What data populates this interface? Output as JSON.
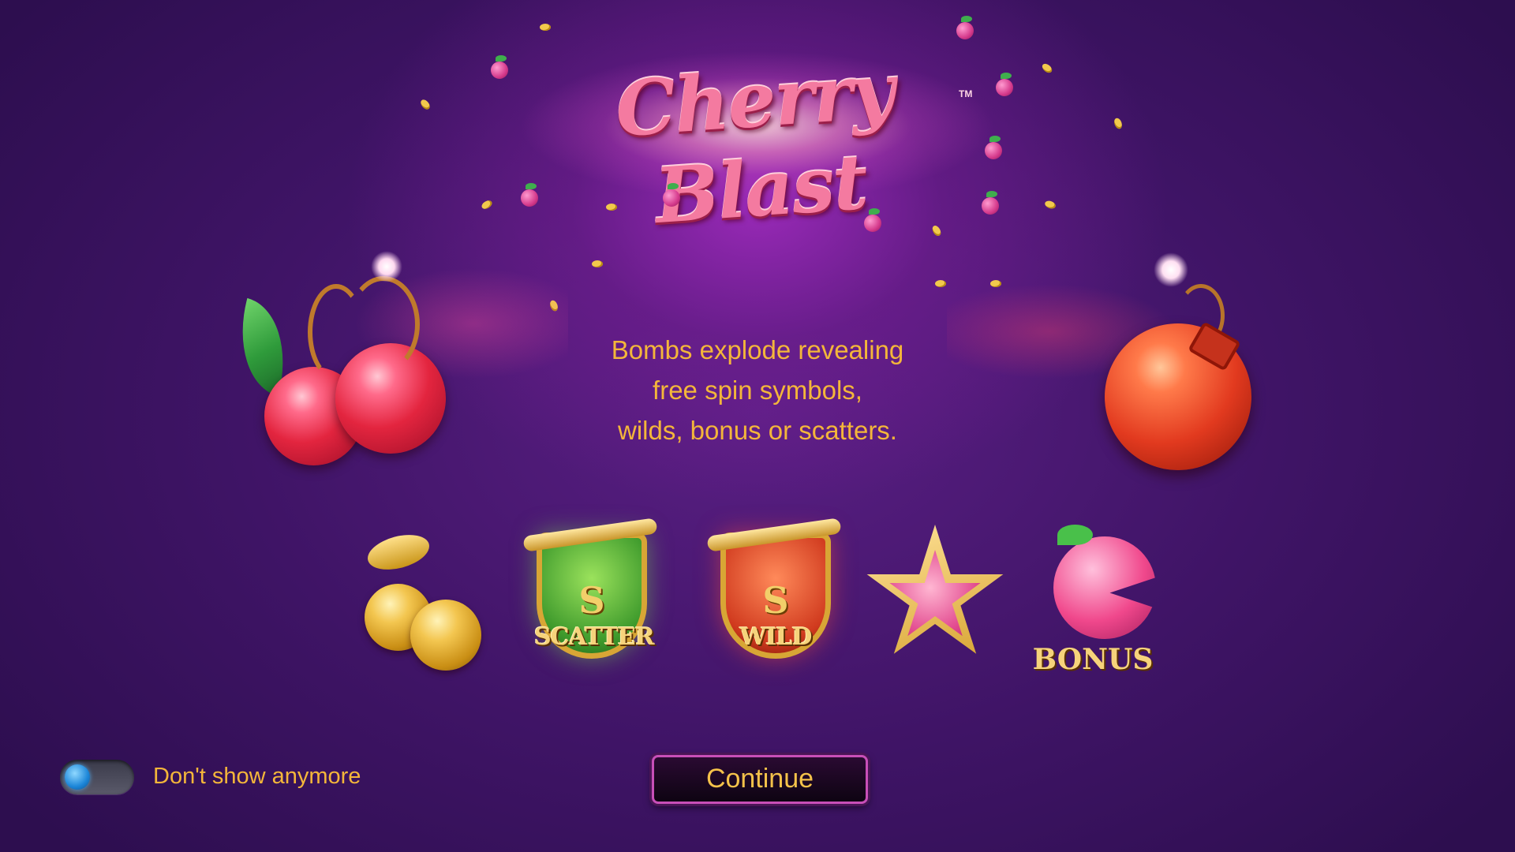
{
  "logo": {
    "title": "Cherry Blast",
    "trademark": "TM"
  },
  "description": {
    "lines": [
      "Bombs explode revealing",
      "free spin symbols,",
      "wilds, bonus or scatters."
    ]
  },
  "symbols": {
    "scatter": {
      "letter": "S",
      "label": "SCATTER"
    },
    "wild": {
      "letter": "S",
      "label": "WILD"
    },
    "bonus": {
      "label": "BONUS"
    }
  },
  "footer": {
    "dont_show_label": "Don't show anymore",
    "dont_show_toggle_on": false,
    "continue_label": "Continue"
  },
  "colors": {
    "accent_text": "#f4b63a",
    "background": "#3f1466",
    "toggle_knob": "#1c86d8"
  }
}
